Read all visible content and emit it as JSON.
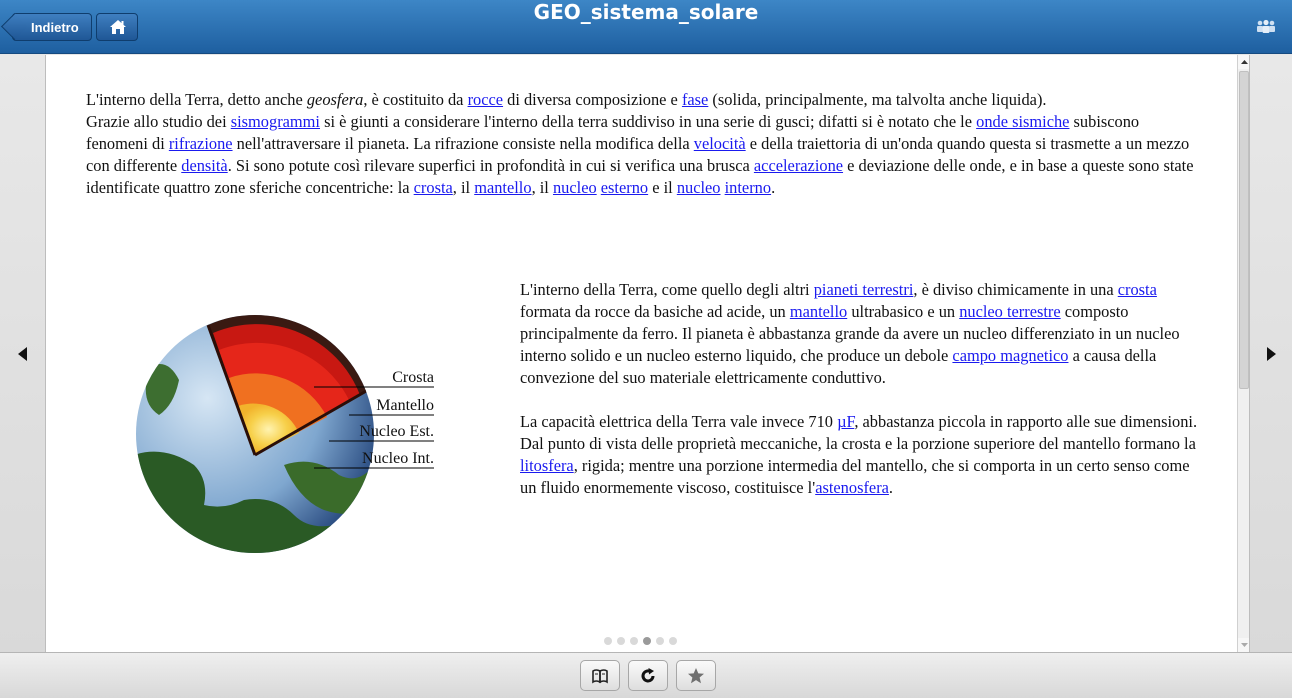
{
  "header": {
    "back_label": "Indietro",
    "title": "GEO_sistema_solare"
  },
  "icons": {
    "home": "home-icon",
    "users": "users-icon",
    "prev": "chevron-left-icon",
    "next": "chevron-right-icon",
    "book": "book-icon",
    "refresh": "refresh-icon",
    "star": "star-icon"
  },
  "colors": {
    "header": "#2a6db0",
    "link": "#1a1aef"
  },
  "paragraph1": [
    {
      "t": "L'interno della Terra, detto anche "
    },
    {
      "t": "geosfera",
      "i": true
    },
    {
      "t": ", è costituito da "
    },
    {
      "t": "rocce",
      "l": true
    },
    {
      "t": " di diversa composizione e "
    },
    {
      "t": "fase",
      "l": true
    },
    {
      "t": " (solida, principalmente, ma talvolta anche liquida)."
    },
    {
      "br": true
    },
    {
      "t": "Grazie allo studio dei "
    },
    {
      "t": "sismogrammi",
      "l": true
    },
    {
      "t": " si è giunti a considerare l'interno della terra suddiviso in una serie di gusci; difatti si è notato che le "
    },
    {
      "t": "onde sismiche",
      "l": true
    },
    {
      "t": " subiscono fenomeni di "
    },
    {
      "t": "rifrazione",
      "l": true
    },
    {
      "t": " nell'attraversare il pianeta. La rifrazione consiste nella modifica della "
    },
    {
      "t": "velocità",
      "l": true
    },
    {
      "t": " e della traiettoria di un'onda quando questa si trasmette a un mezzo con differente "
    },
    {
      "t": "densità",
      "l": true
    },
    {
      "t": ". Si sono potute così rilevare superfici in profondità in cui si verifica una brusca "
    },
    {
      "t": "accelerazione",
      "l": true
    },
    {
      "t": " e deviazione delle onde, e in base a queste sono state identificate quattro zone sferiche concentriche: la "
    },
    {
      "t": "crosta",
      "l": true
    },
    {
      "t": ", il "
    },
    {
      "t": "mantello",
      "l": true
    },
    {
      "t": ", il "
    },
    {
      "t": "nucleo",
      "l": true
    },
    {
      "t": " "
    },
    {
      "t": "esterno",
      "l": true
    },
    {
      "t": " e il "
    },
    {
      "t": "nucleo",
      "l": true
    },
    {
      "t": " "
    },
    {
      "t": "interno",
      "l": true
    },
    {
      "t": "."
    }
  ],
  "paragraph2": [
    {
      "t": "L'interno della Terra, come quello degli altri "
    },
    {
      "t": "pianeti terrestri",
      "l": true
    },
    {
      "t": ", è diviso chimicamente in una "
    },
    {
      "t": "crosta",
      "l": true
    },
    {
      "t": " formata da rocce da basiche ad acide, un "
    },
    {
      "t": "mantello",
      "l": true
    },
    {
      "t": " ultrabasico e un "
    },
    {
      "t": "nucleo terrestre",
      "l": true
    },
    {
      "t": " composto principalmente da ferro. Il pianeta è abbastanza grande da avere un nucleo differenziato in un nucleo interno solido e un nucleo esterno liquido, che produce un debole "
    },
    {
      "t": "campo magnetico",
      "l": true
    },
    {
      "t": " a causa della convezione del suo materiale elettricamente conduttivo."
    }
  ],
  "paragraph3": [
    {
      "t": "La capacità elettrica della Terra vale invece 710 "
    },
    {
      "t": "µF",
      "l": true
    },
    {
      "t": ", abbastanza piccola in rapporto alle sue dimensioni. Dal punto di vista delle proprietà meccaniche, la crosta e la porzione superiore del mantello formano la "
    },
    {
      "t": "litosfera",
      "l": true
    },
    {
      "t": ", rigida; mentre una porzione intermedia del mantello, che si comporta in un certo senso come un fluido enormemente viscoso, costituisce l'"
    },
    {
      "t": "astenosfera",
      "l": true
    },
    {
      "t": "."
    }
  ],
  "figure": {
    "labels": {
      "crust": "Crosta",
      "mantle": "Mantello",
      "outer_core": "Nucleo Est.",
      "inner_core": "Nucleo Int."
    }
  },
  "pager": {
    "total": 6,
    "current": 4
  }
}
